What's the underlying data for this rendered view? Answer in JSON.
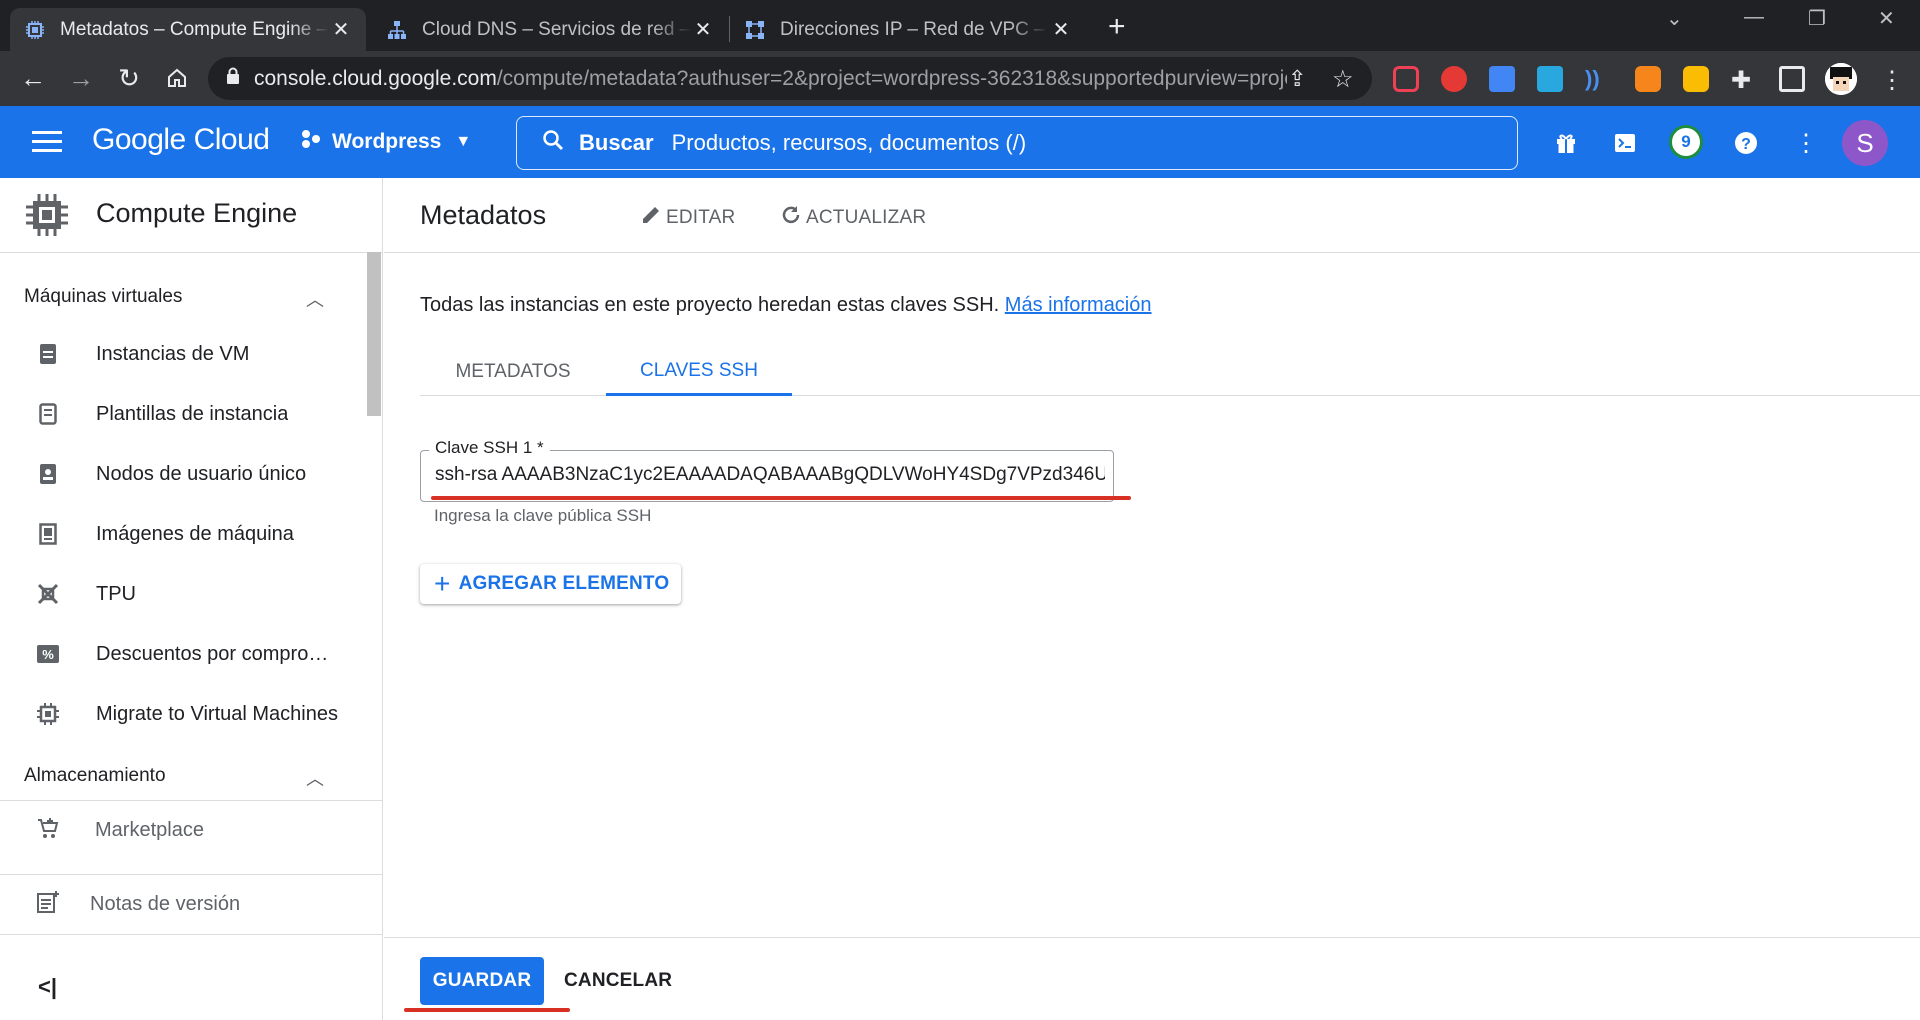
{
  "browser": {
    "tabs": [
      {
        "title": "Metadatos – Compute Engine – W",
        "active": true
      },
      {
        "title": "Cloud DNS – Servicios de red – W",
        "active": false
      },
      {
        "title": "Direcciones IP – Red de VPC – W",
        "active": false
      }
    ],
    "close_glyph": "✕",
    "new_tab_glyph": "+",
    "url_host": "console.cloud.google.com",
    "url_path": "/compute/metadata?authuser=2&project=wordpress-362318&supportedpurview=project"
  },
  "header": {
    "logo": "Google Cloud",
    "project": "Wordpress",
    "search_label": "Buscar",
    "search_placeholder": "Productos, recursos, documentos (/)",
    "notifications_count": "9",
    "avatar_letter": "S",
    "brand_color": "#1a73e8"
  },
  "sidebar": {
    "title": "Compute Engine",
    "section_vm": "Máquinas virtuales",
    "items": [
      {
        "label": "Instancias de VM",
        "icon": "vm-instance-icon"
      },
      {
        "label": "Plantillas de instancia",
        "icon": "instance-template-icon"
      },
      {
        "label": "Nodos de usuario único",
        "icon": "sole-tenant-icon"
      },
      {
        "label": "Imágenes de máquina",
        "icon": "machine-image-icon"
      },
      {
        "label": "TPU",
        "icon": "tpu-icon"
      },
      {
        "label": "Descuentos por compromiso",
        "icon": "discount-icon"
      },
      {
        "label": "Migrate to Virtual Machines",
        "icon": "migrate-icon"
      }
    ],
    "section_storage": "Almacenamiento",
    "marketplace": "Marketplace",
    "release_notes": "Notas de versión",
    "collapse_glyph": "<|"
  },
  "main": {
    "title": "Metadatos",
    "edit_label": "EDITAR",
    "refresh_label": "ACTUALIZAR",
    "description": "Todas las instancias en este proyecto heredan estas claves SSH.",
    "more_info": "Más información",
    "tabs": [
      {
        "label": "METADATOS",
        "selected": false
      },
      {
        "label": "CLAVES SSH",
        "selected": true
      }
    ],
    "ssh_field_label": "Clave SSH 1 *",
    "ssh_field_value": "ssh-rsa AAAAB3NzaC1yc2EAAAADAQABAAABgQDLVWoHY4SDg7VPzd346U",
    "ssh_helper": "Ingresa la clave pública SSH",
    "add_item_label": "AGREGAR ELEMENTO",
    "save_label": "GUARDAR",
    "cancel_label": "CANCELAR",
    "annotation_color": "#d93025"
  }
}
